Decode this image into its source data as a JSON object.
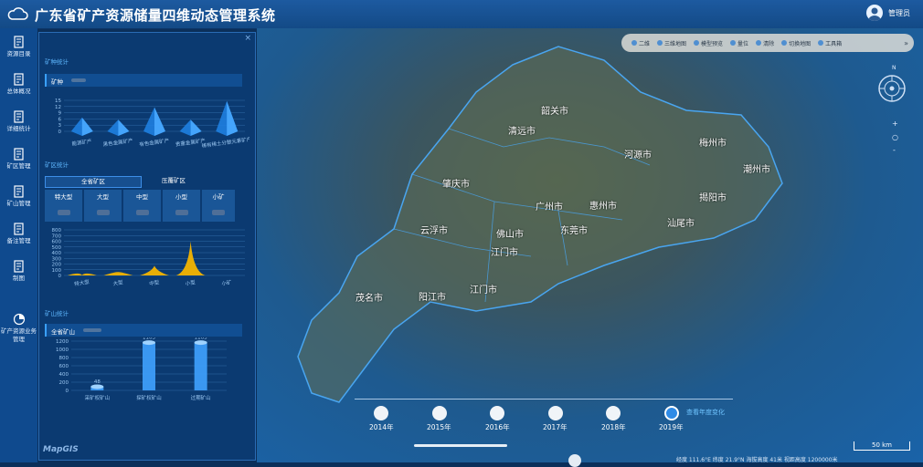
{
  "app": {
    "title": "广东省矿产资源储量四维动态管理系统",
    "user": "管理员"
  },
  "nav": [
    {
      "label": "资源目录",
      "icon": "catalog-icon"
    },
    {
      "label": "总体概况",
      "icon": "overview-icon"
    },
    {
      "label": "详细统计",
      "icon": "statistics-icon"
    },
    {
      "label": "矿区管理",
      "icon": "mining-area-icon"
    },
    {
      "label": "矿山管理",
      "icon": "mine-icon"
    },
    {
      "label": "备注管理",
      "icon": "notes-icon"
    },
    {
      "label": "制图",
      "icon": "mapping-icon"
    },
    {
      "label": "矿产资源业务管理",
      "icon": "pie-chart-icon"
    }
  ],
  "panel": {
    "close": "×",
    "mineral_title": "矿种统计",
    "mineral_bar": "矿种",
    "area_title": "矿区统计",
    "area_tabs": [
      "全省矿区",
      "压覆矿区"
    ],
    "area_tiles": [
      "特大型",
      "大型",
      "中型",
      "小型",
      "小矿"
    ],
    "mine_title": "矿山统计",
    "mine_bar": "全省矿山"
  },
  "chart_data": [
    {
      "type": "bar",
      "title": "",
      "ylim": [
        0,
        15
      ],
      "yticks": [
        0,
        3,
        6,
        9,
        12,
        15
      ],
      "categories": [
        "能源矿产",
        "黑色金属矿产",
        "有色金属矿产",
        "贵重金属矿产",
        "稀有稀土分散元素矿产"
      ],
      "values": [
        4,
        3,
        9,
        3,
        12
      ]
    },
    {
      "type": "area",
      "ylim": [
        0,
        800
      ],
      "yticks": [
        0,
        100,
        200,
        300,
        400,
        500,
        600,
        700,
        800
      ],
      "categories": [
        "特大型",
        "大型",
        "中型",
        "小型",
        "小矿"
      ],
      "values": [
        5,
        60,
        170,
        600,
        0
      ]
    },
    {
      "type": "bar",
      "ylim": [
        0,
        1200
      ],
      "yticks": [
        0,
        200,
        400,
        600,
        800,
        1000,
        1200
      ],
      "categories": [
        "采矿权矿山",
        "探矿权矿山",
        "过期矿山"
      ],
      "values": [
        48,
        1163,
        1163
      ],
      "data_labels": [
        "48",
        "1163",
        "1163"
      ]
    }
  ],
  "map": {
    "toolbar": [
      "二维",
      "三维地图",
      "模型预览",
      "量位",
      "清除",
      "切换地图",
      "工具箱"
    ],
    "toolbar_more": "»",
    "cities": [
      {
        "name": "韶关市"
      },
      {
        "name": "清远市"
      },
      {
        "name": "河源市"
      },
      {
        "name": "梅州市"
      },
      {
        "name": "潮州市"
      },
      {
        "name": "揭阳市"
      },
      {
        "name": "汕尾市"
      },
      {
        "name": "肇庆市"
      },
      {
        "name": "广州市"
      },
      {
        "name": "惠州市"
      },
      {
        "name": "东莞市"
      },
      {
        "name": "佛山市"
      },
      {
        "name": "江门市"
      },
      {
        "name": "云浮市"
      },
      {
        "name": "茂名市"
      },
      {
        "name": "阳江市"
      },
      {
        "name": "江门市"
      }
    ],
    "timeline": [
      "2014年",
      "2015年",
      "2016年",
      "2017年",
      "2018年",
      "2019年"
    ],
    "timeline_label": "查看年度变化",
    "scale": "50 km",
    "zoom_in": "+",
    "zoom_reset": "○",
    "zoom_out": "-",
    "compass_n": "N",
    "watermark": "MapGIS",
    "status": "经度 111.6°E  纬度 21.9°N  海拔高度 41米  视距高度 1200000米"
  }
}
